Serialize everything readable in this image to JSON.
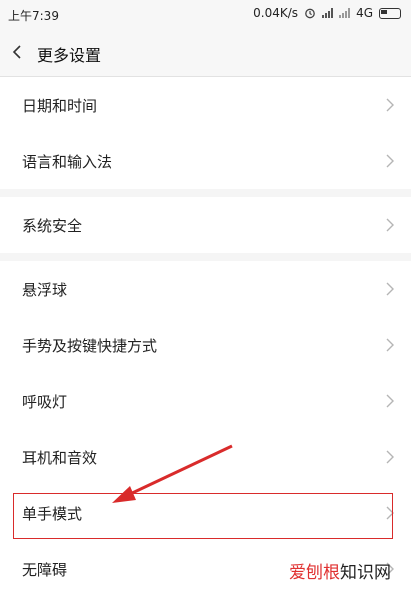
{
  "status_bar": {
    "time": "上午7:39",
    "net_speed": "0.04K/s",
    "network": "4G"
  },
  "header": {
    "title": "更多设置"
  },
  "groups": [
    {
      "items": [
        {
          "label": "日期和时间"
        },
        {
          "label": "语言和输入法"
        }
      ]
    },
    {
      "items": [
        {
          "label": "系统安全"
        }
      ]
    },
    {
      "items": [
        {
          "label": "悬浮球"
        },
        {
          "label": "手势及按键快捷方式"
        },
        {
          "label": "呼吸灯"
        },
        {
          "label": "耳机和音效"
        },
        {
          "label": "单手模式"
        },
        {
          "label": "无障碍"
        }
      ]
    }
  ],
  "annotation": {
    "highlight_color": "#d92b2b",
    "highlighted_item": "单手模式"
  },
  "watermark": {
    "brand": "爱刨根",
    "suffix": "知识网"
  }
}
